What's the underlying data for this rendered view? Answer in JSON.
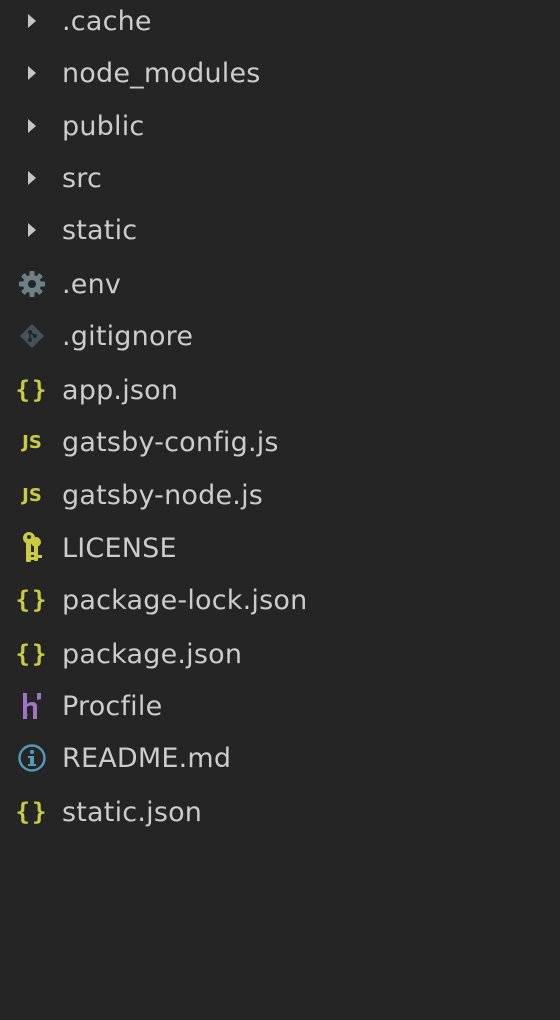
{
  "explorer": {
    "items": [
      {
        "label": ".cache",
        "kind": "folder",
        "icon": "chevron-right-icon"
      },
      {
        "label": "node_modules",
        "kind": "folder",
        "icon": "chevron-right-icon"
      },
      {
        "label": "public",
        "kind": "folder",
        "icon": "chevron-right-icon"
      },
      {
        "label": "src",
        "kind": "folder",
        "icon": "chevron-right-icon"
      },
      {
        "label": "static",
        "kind": "folder",
        "icon": "chevron-right-icon"
      },
      {
        "label": ".env",
        "kind": "file",
        "icon": "gear-icon"
      },
      {
        "label": ".gitignore",
        "kind": "file",
        "icon": "git-icon"
      },
      {
        "label": "app.json",
        "kind": "file",
        "icon": "json-icon",
        "glyph": "{}"
      },
      {
        "label": "gatsby-config.js",
        "kind": "file",
        "icon": "javascript-icon",
        "glyph": "JS"
      },
      {
        "label": "gatsby-node.js",
        "kind": "file",
        "icon": "javascript-icon",
        "glyph": "JS"
      },
      {
        "label": "LICENSE",
        "kind": "file",
        "icon": "license-key-icon"
      },
      {
        "label": "package-lock.json",
        "kind": "file",
        "icon": "json-icon",
        "glyph": "{}"
      },
      {
        "label": "package.json",
        "kind": "file",
        "icon": "json-icon",
        "glyph": "{}"
      },
      {
        "label": "Procfile",
        "kind": "file",
        "icon": "heroku-icon"
      },
      {
        "label": "README.md",
        "kind": "file",
        "icon": "info-icon"
      },
      {
        "label": "static.json",
        "kind": "file",
        "icon": "json-icon",
        "glyph": "{}"
      }
    ]
  },
  "colors": {
    "background": "#252526",
    "text": "#cccccc",
    "chevron": "#c5c5c5",
    "gear": "#6d8086",
    "git": "#41535b",
    "json": "#cbcb41",
    "js": "#cbcb41",
    "license": "#cbcb41",
    "heroku": "#a074c4",
    "info": "#519aba"
  }
}
